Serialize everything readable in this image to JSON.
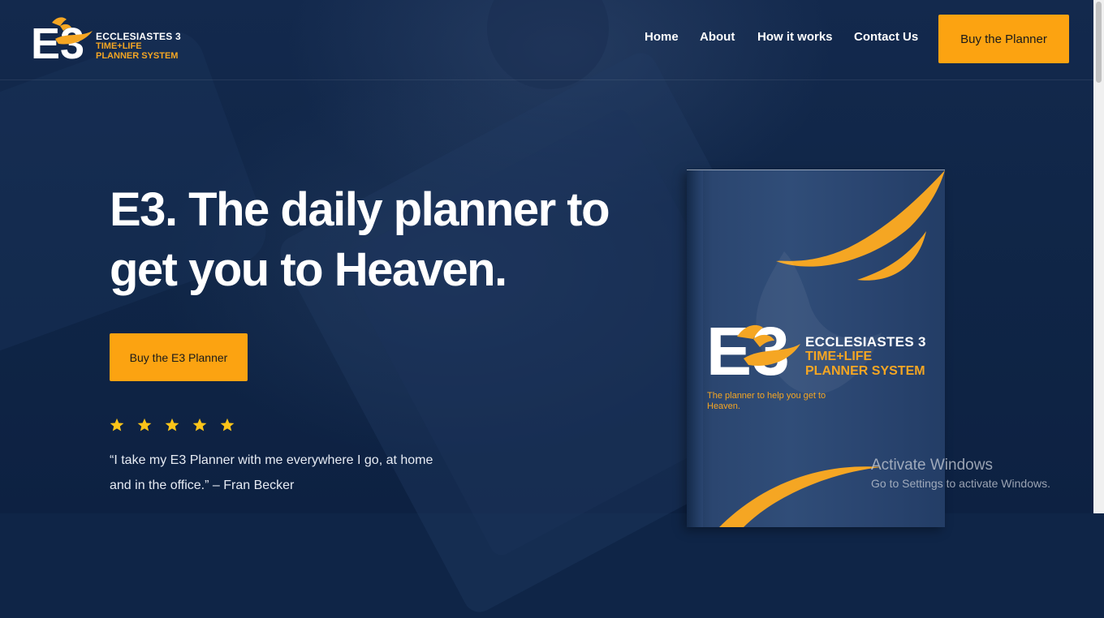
{
  "header": {
    "logo": {
      "mark": "E3",
      "line1": "ECCLESIASTES 3",
      "line2": "TIME+LIFE",
      "line3": "PLANNER SYSTEM"
    },
    "nav": [
      {
        "label": "Home"
      },
      {
        "label": "About"
      },
      {
        "label": "How it works"
      },
      {
        "label": "Contact Us"
      }
    ],
    "cta_label": "Buy the Planner"
  },
  "hero": {
    "title": "E3. The daily planner to get you to Heaven.",
    "cta_label": "Buy the E3 Planner",
    "rating": {
      "stars": 5,
      "out_of": 5
    },
    "testimonial": "“I take my E3 Planner with me everywhere I go, at home and in the office.” – Fran Becker"
  },
  "book": {
    "mark": "E3",
    "line1": "ECCLESIASTES 3",
    "line2": "TIME+LIFE",
    "line3": "PLANNER SYSTEM",
    "tagline": "The planner to help you get to Heaven."
  },
  "watermark": {
    "title": "Activate Windows",
    "subtitle": "Go to Settings to activate Windows."
  },
  "colors": {
    "background": "#0f2547",
    "accent": "#fca311",
    "gold_text": "#f5a623",
    "white": "#ffffff"
  },
  "icons": [
    "bird-icon",
    "star-icon"
  ]
}
